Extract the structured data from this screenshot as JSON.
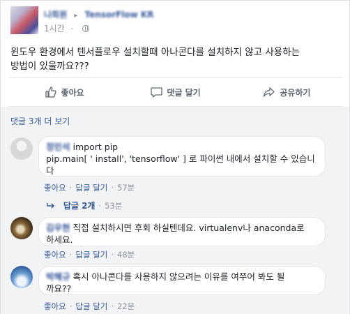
{
  "post": {
    "author": "나희원",
    "group": "TensorFlow KR",
    "time": "1시간",
    "text_line1": "윈도우 환경에서 텐서플로우 설치할때 아나콘다를 설치하지 않고 사용하는",
    "text_line2": "방법이 있을까요???"
  },
  "actions": {
    "like": "좋아요",
    "comment": "댓글 달기",
    "share": "공유하기"
  },
  "comments": {
    "more_link": "댓글 3개 더 보기",
    "items": [
      {
        "author": "정민석",
        "line1": "import pip",
        "line2": "pip.main[ ' install', 'tensorflow' ] 로 파이썬 내에서 설치할 수 있습니",
        "line3": "다",
        "like": "좋아요",
        "reply": "답글 달기",
        "time": "57분"
      },
      {
        "author": "김우현",
        "line1": "직접 설치하시면 후회 하실텐데요. virtualenv나 anaconda로",
        "line2": "하세요.",
        "like": "좋아요",
        "reply": "답글 달기",
        "time": "48분"
      },
      {
        "author": "박혜규",
        "line1": "혹시 아나콘다를 사용하지 않으려는 이유를 여쭈어 봐도 될",
        "line2": "까요??",
        "like": "좋아요",
        "reply": "답글 달기",
        "time": "22분"
      }
    ],
    "reply_thread": {
      "label": "답글 2개",
      "time": "53분"
    }
  },
  "colors": {
    "link": "#385898",
    "muted": "#90949c",
    "border": "#dddfe2",
    "comment_bg": "#f2f3f5"
  },
  "icons": [
    "globe-icon",
    "thumbs-up-icon",
    "comment-icon",
    "share-icon",
    "reply-arrow-icon"
  ]
}
